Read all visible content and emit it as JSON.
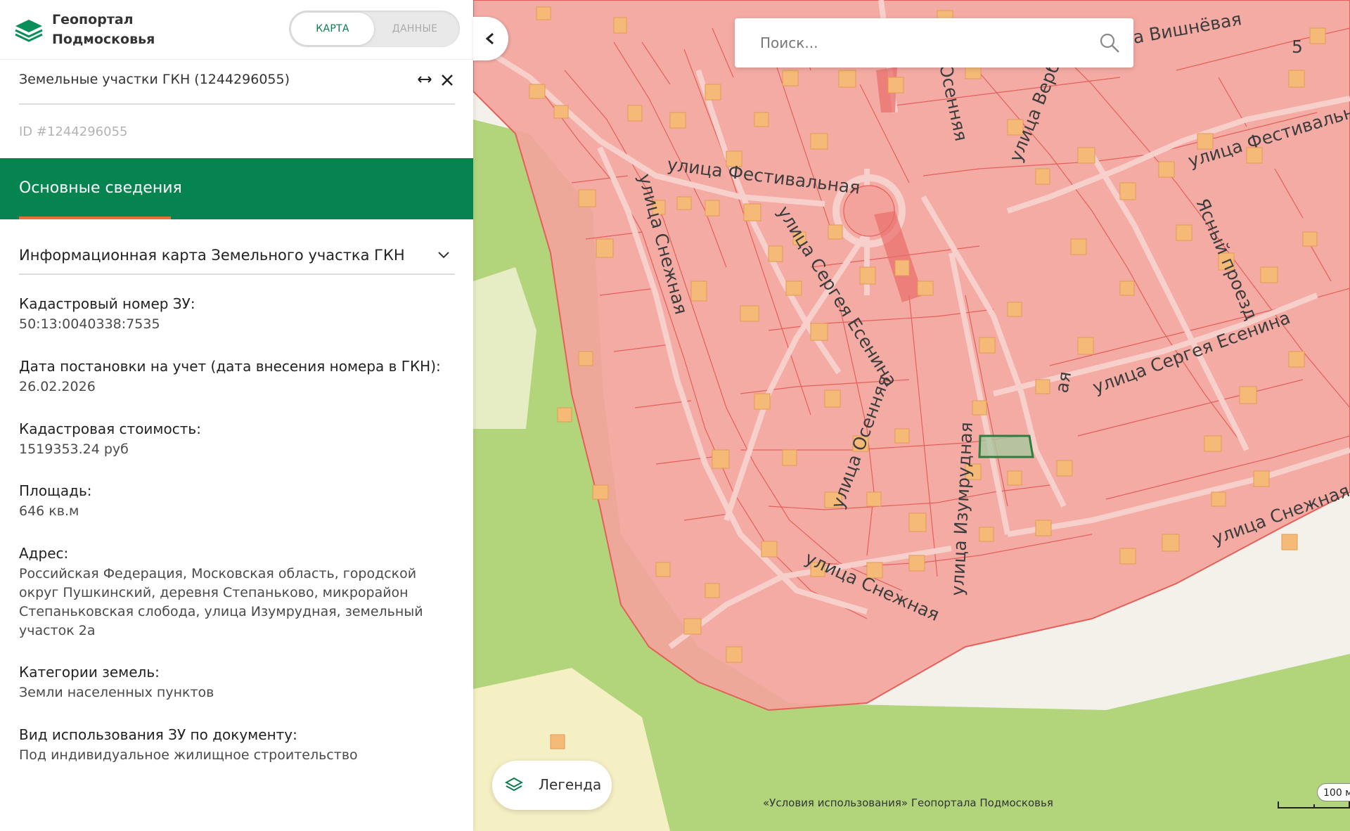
{
  "header": {
    "brand_line1": "Геопортал",
    "brand_line2": "Подмосковья",
    "toggle_map": "КАРТА",
    "toggle_data": "ДАННЫЕ"
  },
  "panel": {
    "layer_title": "Земельные участки ГКН (1244296055)",
    "id_text": "ID #1244296055",
    "tab_label": "Основные сведения",
    "info_card_label": "Информационная карта Земельного участка ГКН"
  },
  "fields": [
    {
      "label": "Кадастровый номер ЗУ:",
      "value": "50:13:0040338:7535"
    },
    {
      "label": "Дата постановки на учет (дата внесения номера в ГКН):",
      "value": "26.02.2026"
    },
    {
      "label": "Кадастровая стоимость:",
      "value": "1519353.24 руб"
    },
    {
      "label": "Площадь:",
      "value": "646 кв.м"
    },
    {
      "label": "Адрес:",
      "value": "Российская Федерация, Московская область, городской округ Пушкинский, деревня Степаньково, микрорайон Степаньковская слобода, улица Изумрудная, земельный участок 2а"
    },
    {
      "label": "Категории земель:",
      "value": "Земли населенных пунктов"
    },
    {
      "label": "Вид использования ЗУ по документу:",
      "value": "Под индивидуальное жилищное строительство"
    }
  ],
  "map": {
    "search_placeholder": "Поиск...",
    "legend_label": "Легенда",
    "terms_text": "«Условия использования» Геопортала Подмосковья",
    "scale_label": "100 м",
    "streets": {
      "festivalnaya_1": "улица Фестивальная",
      "festivalnaya_2": "улица Фестивальн",
      "snezhnaya_1": "улица Снежная",
      "snezhnaya_2": "улица Снежная",
      "snezhnaya_3": "улица Снежная",
      "esenina_1": "улица Сергея Есенина",
      "esenina_2": "улица Сергея Есенина",
      "osennyaya_1": "улица Осенняя",
      "osennyaya_2": "Осенняя",
      "izumrudnaya": "улица Изумрудная",
      "verbnaya": "улица Верб",
      "vishnevaya": "а Вишнёвая",
      "yasny": "Ясный проезд",
      "aya": "ая",
      "house_5": "5"
    },
    "colors": {
      "zone_fill": "#f4a39c",
      "zone_stroke": "#e5605a",
      "forest": "#b2d57c",
      "selected_parcel": "#2f7d3e",
      "brand_green": "#05844f",
      "tab_accent": "#e2713a"
    }
  }
}
